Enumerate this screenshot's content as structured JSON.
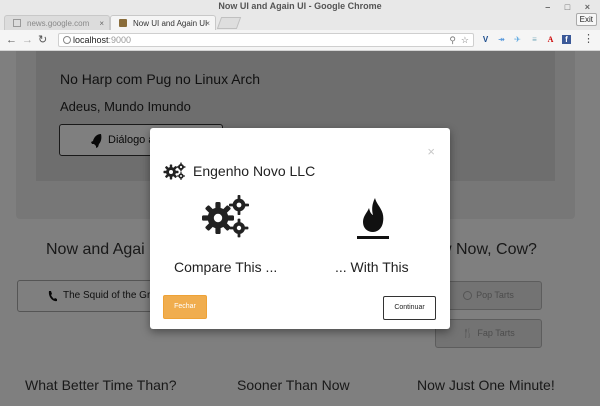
{
  "window": {
    "title": "Now UI and Again UI - Google Chrome",
    "exit_label": "Exit"
  },
  "tabs": [
    {
      "label": "news.google.com"
    },
    {
      "label": "Now UI and Again UI"
    }
  ],
  "address_bar": {
    "host": "localhost",
    "port": ":9000"
  },
  "page": {
    "heading": "No Harp com Pug no Linux Arch",
    "subheading": "Adeus, Mundo Imundo",
    "dialog_button": "Diálogo a",
    "section_left_title": "Now and Agai",
    "section_right_title": "w Now, Cow?",
    "squid_button": "The Squid of the Gr",
    "pop_tarts_button": "Pop Tarts",
    "fap_tarts_button": "Fap Tarts",
    "bottom_headings": [
      "What Better Time Than?",
      "Sooner Than Now",
      "Now Just One Minute!"
    ]
  },
  "modal": {
    "title": "Engenho Novo LLC",
    "close_glyph": "×",
    "left_caption": "Compare This ...",
    "right_caption": "... With This",
    "close_button": "Fechar",
    "continue_button": "Continuar"
  },
  "colors": {
    "warning": "#f0ad4e",
    "overlay": "rgba(0,0,0,0.5)"
  }
}
